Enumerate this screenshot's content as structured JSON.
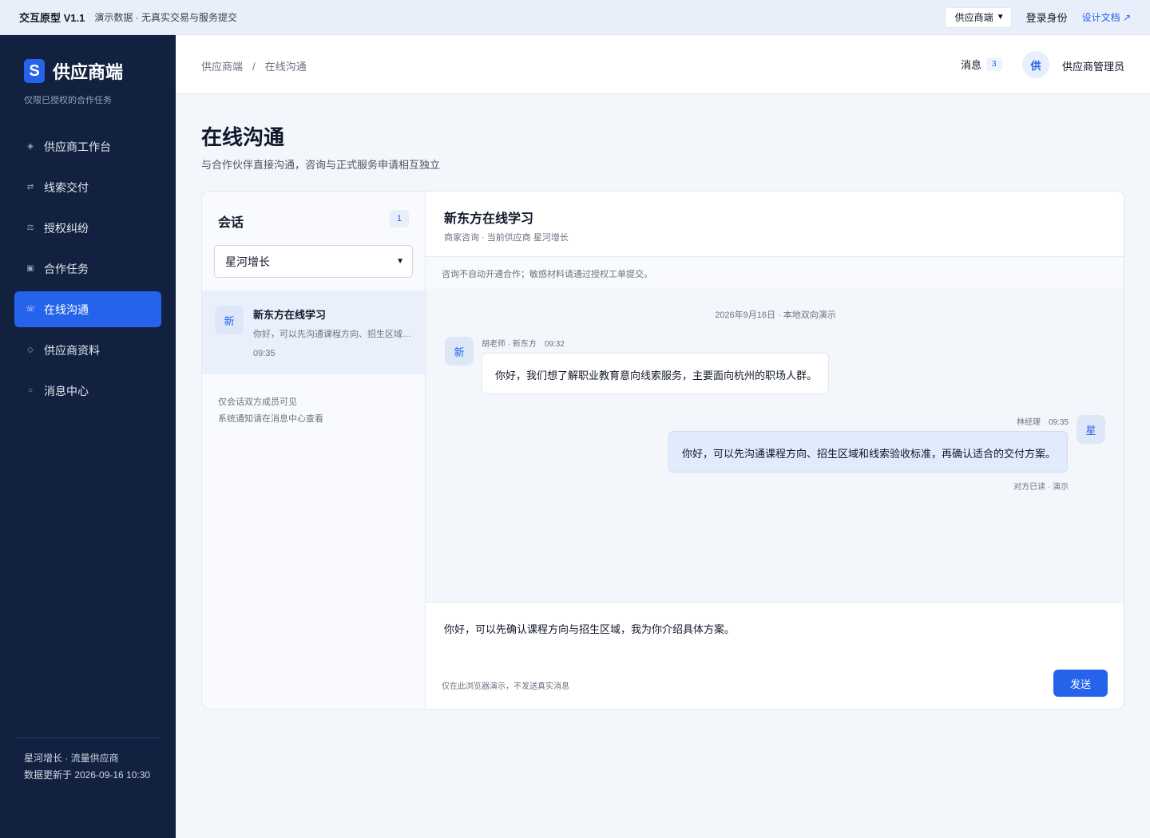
{
  "topbar": {
    "prototype": "交互原型 V1.1",
    "demo_note": "演示数据 · 无真实交易与服务提交",
    "role_selected": "供应商端",
    "login_label": "登录身份",
    "docs_label": "设计文档 ↗"
  },
  "sidebar": {
    "logo_letter": "S",
    "title": "供应商端",
    "subtitle": "仅限已授权的合作任务",
    "items": [
      {
        "label": "供应商工作台",
        "icon": "◈",
        "icon_name": "dashboard-icon"
      },
      {
        "label": "线索交付",
        "icon": "⇄",
        "icon_name": "transfer-icon"
      },
      {
        "label": "授权纠纷",
        "icon": "⚖",
        "icon_name": "scale-icon"
      },
      {
        "label": "合作任务",
        "icon": "▣",
        "icon_name": "task-icon"
      },
      {
        "label": "在线沟通",
        "icon": "☏",
        "icon_name": "chat-icon",
        "active": true
      },
      {
        "label": "供应商资料",
        "icon": "◇",
        "icon_name": "profile-icon"
      },
      {
        "label": "消息中心",
        "icon": "○",
        "icon_name": "bell-icon"
      }
    ],
    "footer": {
      "company": "星河增长 · 流量供应商",
      "updated": "数据更新于 2026-09-16 10:30"
    }
  },
  "header": {
    "breadcrumb": [
      "供应商端",
      "在线沟通"
    ],
    "breadcrumb_sep": "/",
    "messages_label": "消息",
    "messages_count": "3",
    "avatar_char": "供",
    "user_name": "供应商管理员"
  },
  "page": {
    "title": "在线沟通",
    "subtitle": "与合作伙伴直接沟通，咨询与正式服务申请相互独立"
  },
  "conversations": {
    "title": "会话",
    "count": "1",
    "filter_selected": "星河增长",
    "threads": [
      {
        "avatar": "新",
        "name": "新东方在线学习",
        "preview": "你好，可以先沟通课程方向、招生区域和线索验收标准，再确认适合的交付方案。",
        "time": "09:35"
      }
    ],
    "visibility_note_1": "仅会话双方成员可见",
    "visibility_note_2": "系统通知请在消息中心查看"
  },
  "chat": {
    "title": "新东方在线学习",
    "meta": "商家咨询 · 当前供应商 星河增长",
    "notice": "咨询不自动开通合作；敏感材料请通过授权工单提交。",
    "date_separator": "2026年9月16日 · 本地双向演示",
    "messages": [
      {
        "direction": "incoming",
        "avatar": "新",
        "sender": "胡老师 · 新东方",
        "time": "09:32",
        "text": "你好，我们想了解职业教育意向线索服务，主要面向杭州的职场人群。"
      },
      {
        "direction": "outgoing",
        "avatar": "星",
        "sender": "林经理",
        "time": "09:35",
        "text": "你好，可以先沟通课程方向、招生区域和线索验收标准，再确认适合的交付方案。",
        "status": "对方已读 · 演示"
      }
    ],
    "draft": "你好，可以先确认课程方向与招生区域，我为你介绍具体方案。",
    "hint": "仅在此浏览器演示，不发送真实消息",
    "send_label": "发送"
  },
  "colors": {
    "accent": "#2563eb",
    "sidebar_bg": "#12213f",
    "page_bg": "#f3f6fb"
  }
}
